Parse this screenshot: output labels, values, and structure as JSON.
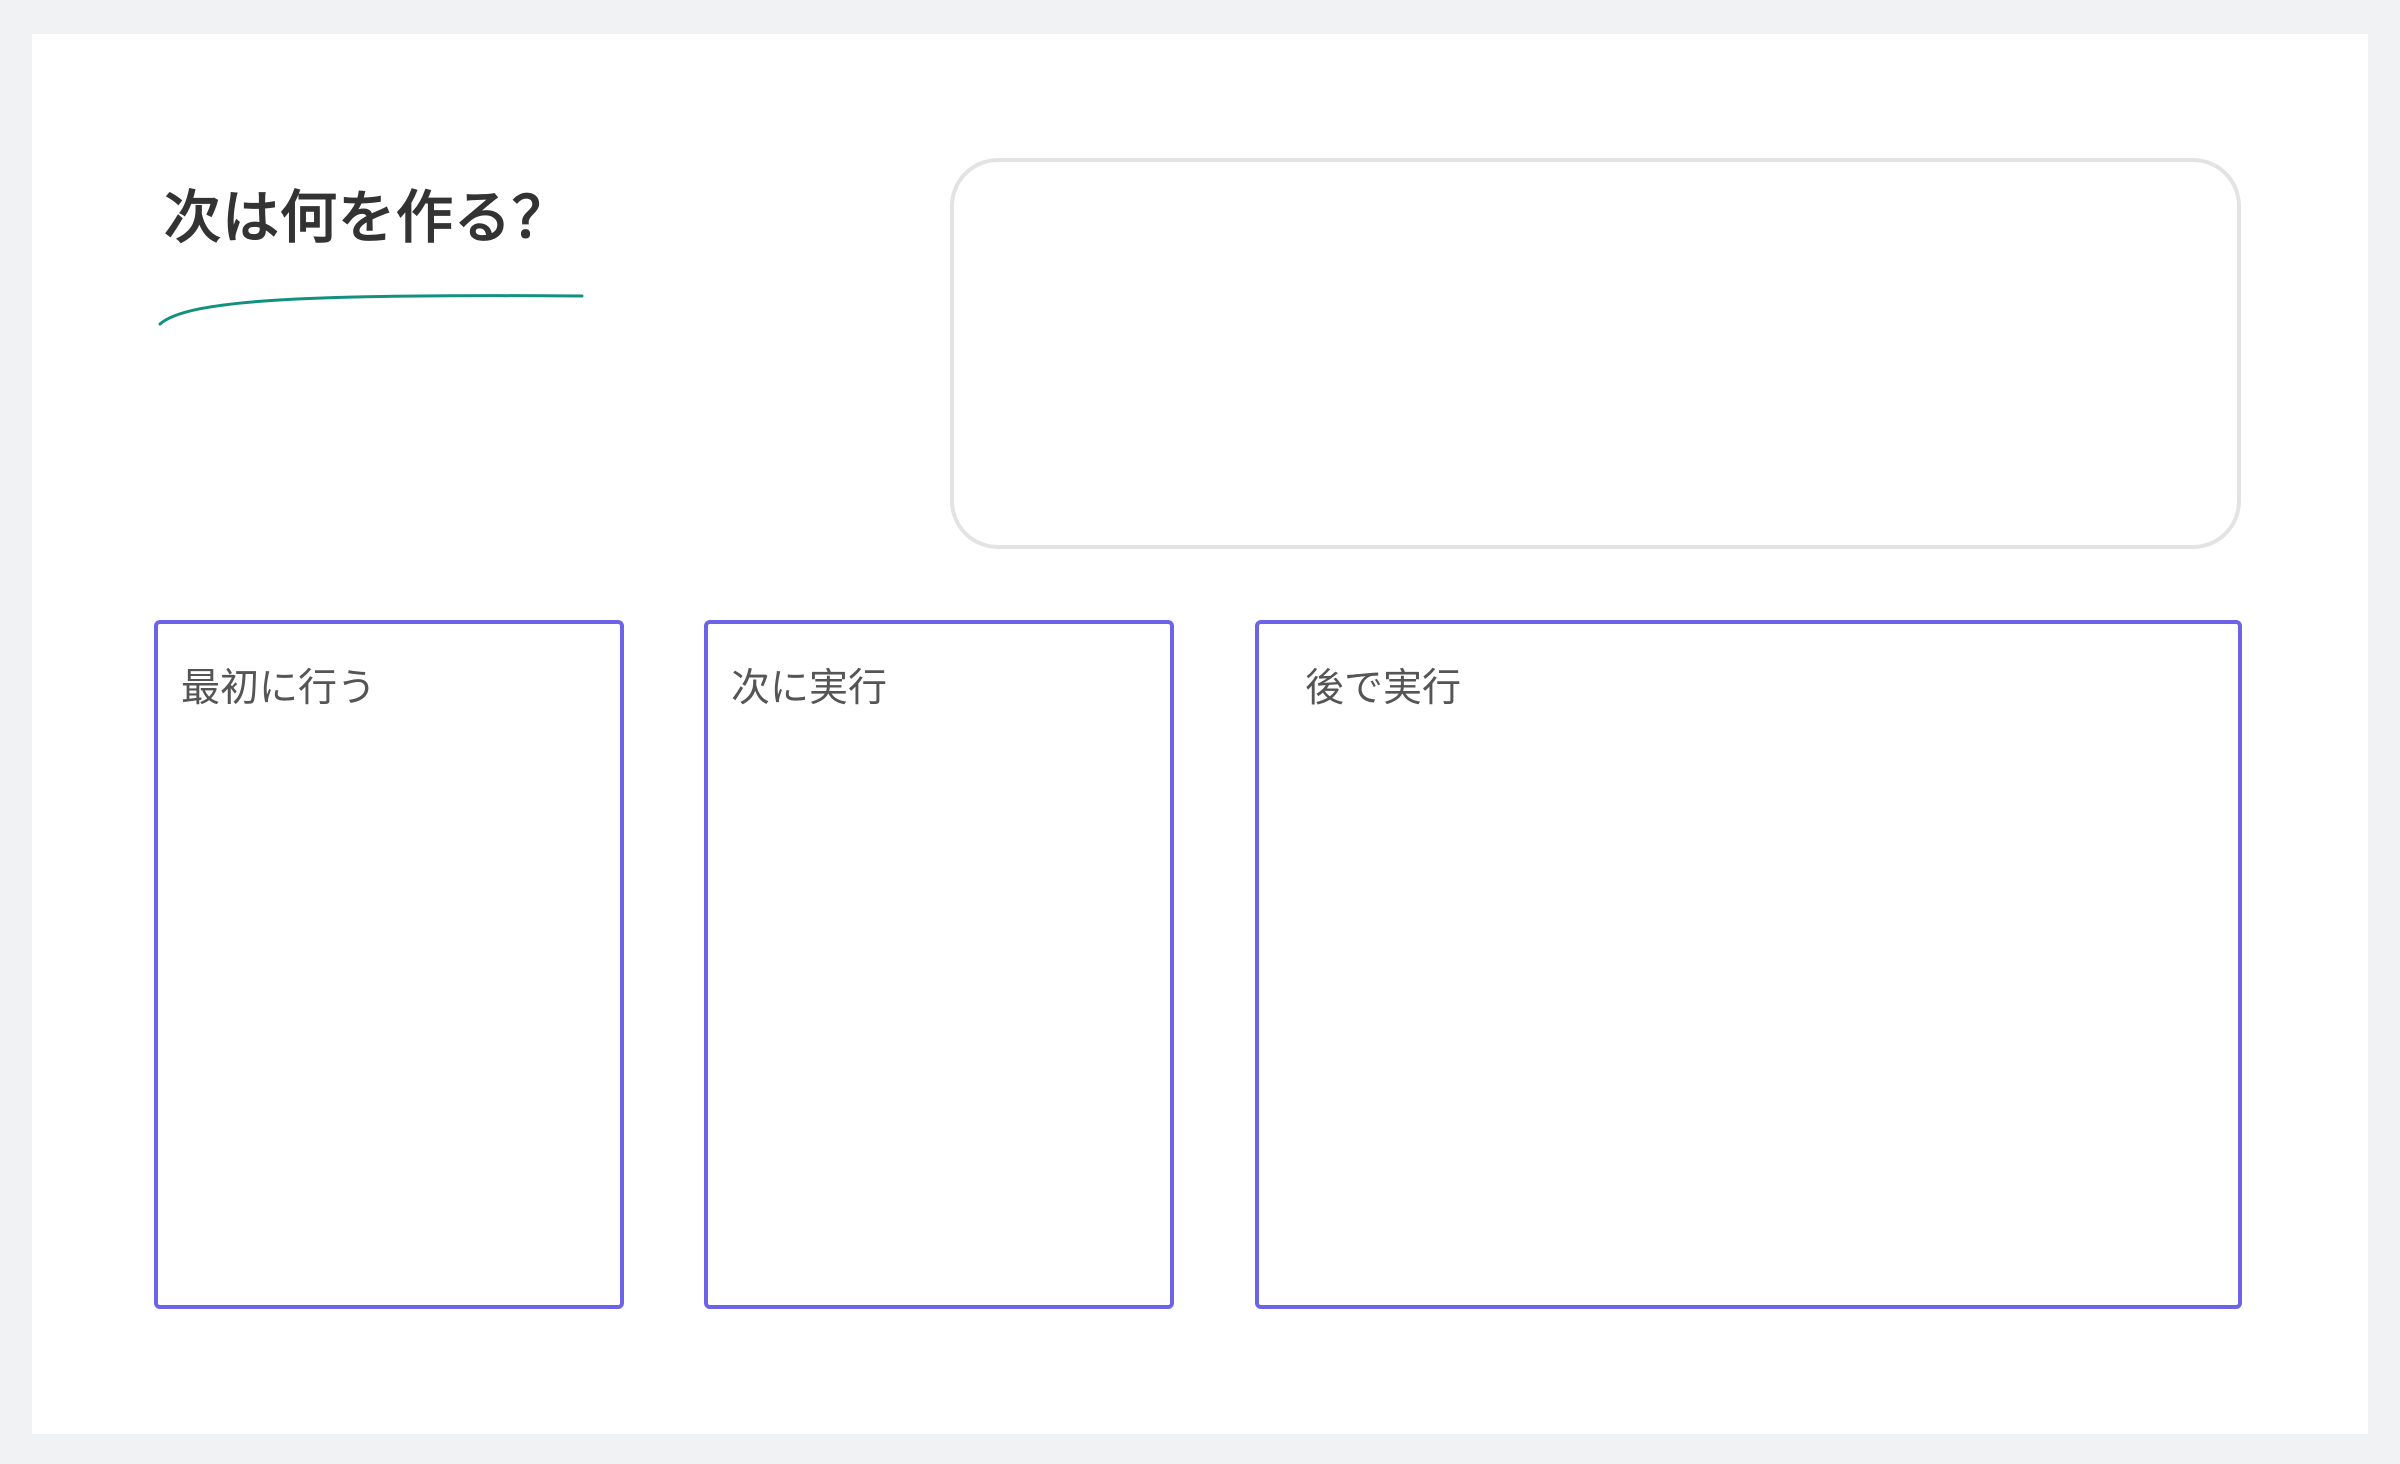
{
  "board": {
    "title": "次は何を作る？",
    "accent_color": "#13907f",
    "columns": [
      {
        "label": "最初に行う"
      },
      {
        "label": "次に実行"
      },
      {
        "label": "後で実行"
      }
    ],
    "column_border_color": "#6c63e8",
    "prompt_box_border_color": "#e3e3e3"
  }
}
